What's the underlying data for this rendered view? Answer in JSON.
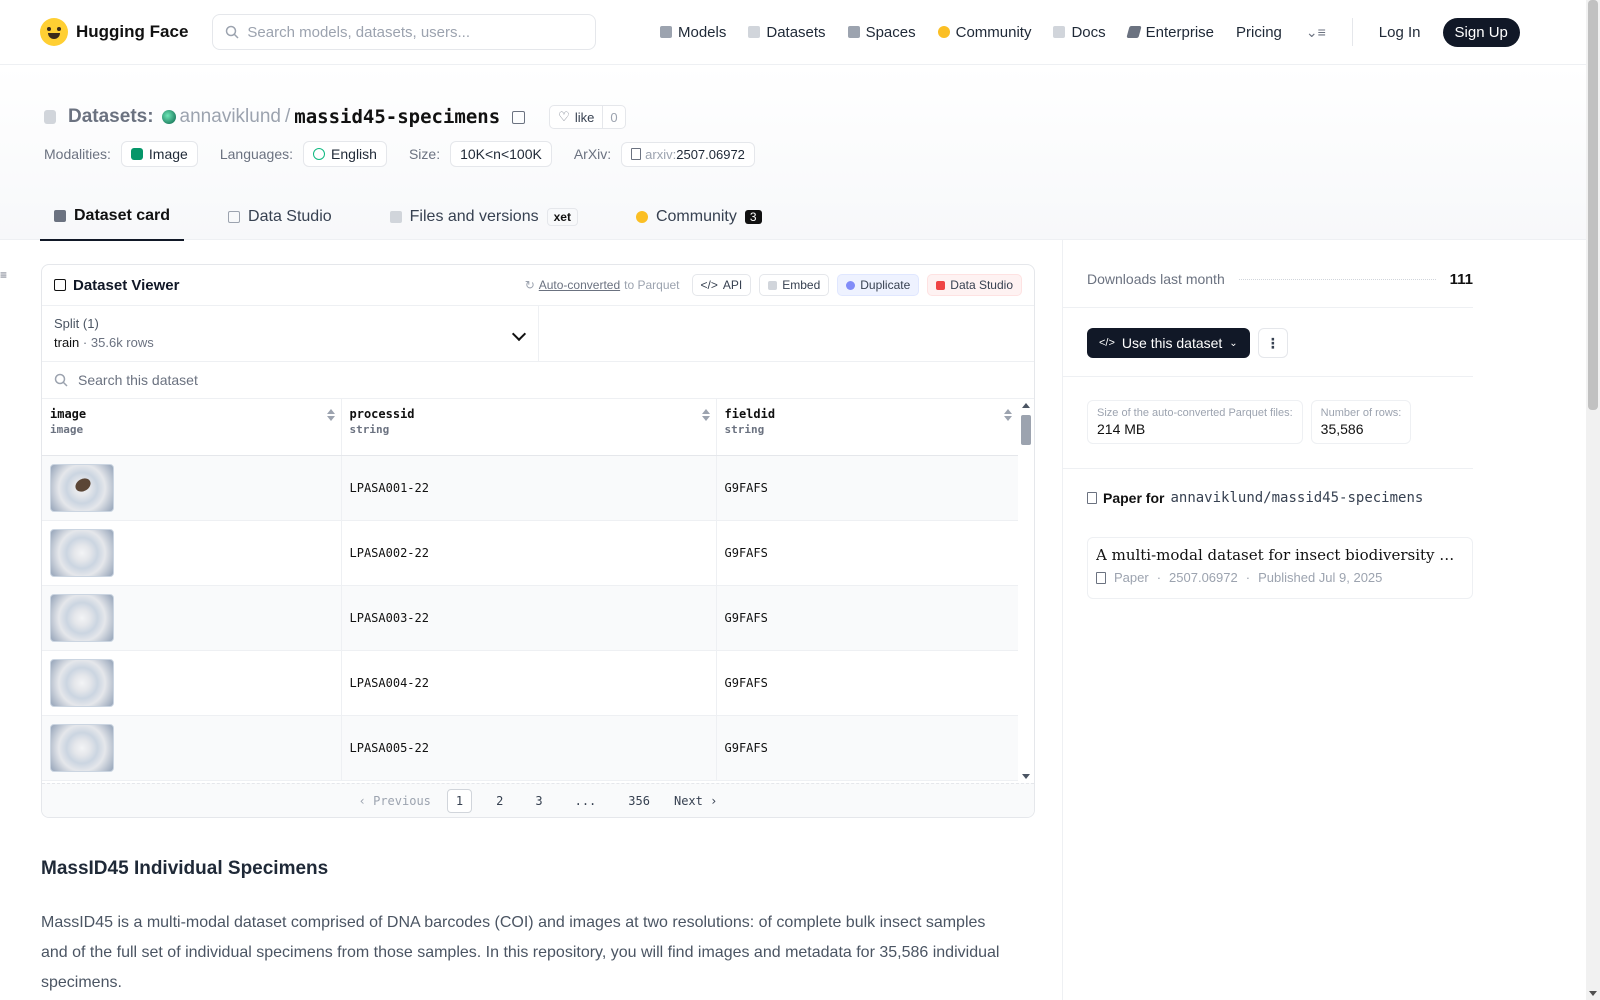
{
  "topnav": {
    "brand": "Hugging Face",
    "search_placeholder": "Search models, datasets, users...",
    "links": [
      {
        "label": "Models",
        "icon": "cube-icon",
        "color": "#9ca3af"
      },
      {
        "label": "Datasets",
        "icon": "database-icon",
        "color": "#d1d5db"
      },
      {
        "label": "Spaces",
        "icon": "spaces-icon",
        "color": "#9ca3af"
      },
      {
        "label": "Community",
        "icon": "hands-icon",
        "color": "#fbbf24"
      },
      {
        "label": "Docs",
        "icon": "book-icon",
        "color": "#d1d5db"
      },
      {
        "label": "Enterprise",
        "icon": "enterprise-icon",
        "color": "#6b7280"
      },
      {
        "label": "Pricing"
      }
    ],
    "login": "Log In",
    "signup": "Sign Up"
  },
  "header": {
    "section": "Datasets:",
    "owner": "annaviklund",
    "sep": "/",
    "repo": "massid45-specimens",
    "like_label": "like",
    "like_count": "0",
    "tags": {
      "modalities_label": "Modalities:",
      "modality": "Image",
      "languages_label": "Languages:",
      "language": "English",
      "size_label": "Size:",
      "size": "10K<n<100K",
      "arxiv_label": "ArXiv:",
      "arxiv_prefix": "arxiv:",
      "arxiv_id": "2507.06972"
    },
    "tabs": {
      "card": "Dataset card",
      "studio": "Data Studio",
      "files": "Files and versions",
      "xet": "xet",
      "community": "Community",
      "community_count": "3"
    }
  },
  "viewer": {
    "title": "Dataset Viewer",
    "auto_converted": "Auto-converted",
    "to_parquet": "to Parquet",
    "api": "API",
    "embed": "Embed",
    "duplicate": "Duplicate",
    "data_studio": "Data Studio",
    "split_label": "Split (1)",
    "split_name": "train",
    "split_dot": "·",
    "split_rows": "35.6k rows",
    "search_placeholder": "Search this dataset",
    "columns": [
      {
        "name": "image",
        "type": "image"
      },
      {
        "name": "processid",
        "type": "string"
      },
      {
        "name": "fieldid",
        "type": "string"
      }
    ],
    "rows": [
      {
        "processid": "LPASA001-22",
        "fieldid": "G9FAFS"
      },
      {
        "processid": "LPASA002-22",
        "fieldid": "G9FAFS"
      },
      {
        "processid": "LPASA003-22",
        "fieldid": "G9FAFS"
      },
      {
        "processid": "LPASA004-22",
        "fieldid": "G9FAFS"
      },
      {
        "processid": "LPASA005-22",
        "fieldid": "G9FAFS"
      }
    ],
    "pager": {
      "prev": "Previous",
      "pages": [
        "1",
        "2",
        "3",
        "...",
        "356"
      ],
      "next": "Next"
    }
  },
  "card": {
    "title": "MassID45 Individual Specimens",
    "body": "MassID45 is a multi-modal dataset comprised of DNA barcodes (COI) and images at two resolutions: of complete bulk insect samples and of the full set of individual specimens from those samples. In this repository, you will find images and metadata for 35,586 individual specimens."
  },
  "sidebar": {
    "downloads_label": "Downloads last month",
    "downloads": "111",
    "use_button": "Use this dataset",
    "parquet_size_label": "Size of the auto-converted Parquet files:",
    "parquet_size": "214 MB",
    "rows_label": "Number of rows:",
    "rows": "35,586",
    "paper_for": "Paper for",
    "paper_repo": "annaviklund/massid45-specimens",
    "paper_title": "A multi-modal dataset for insect biodiversity with imaging and DNA barcodes",
    "paper_kind": "Paper",
    "paper_id": "2507.06972",
    "paper_published": "Published Jul 9, 2025"
  }
}
